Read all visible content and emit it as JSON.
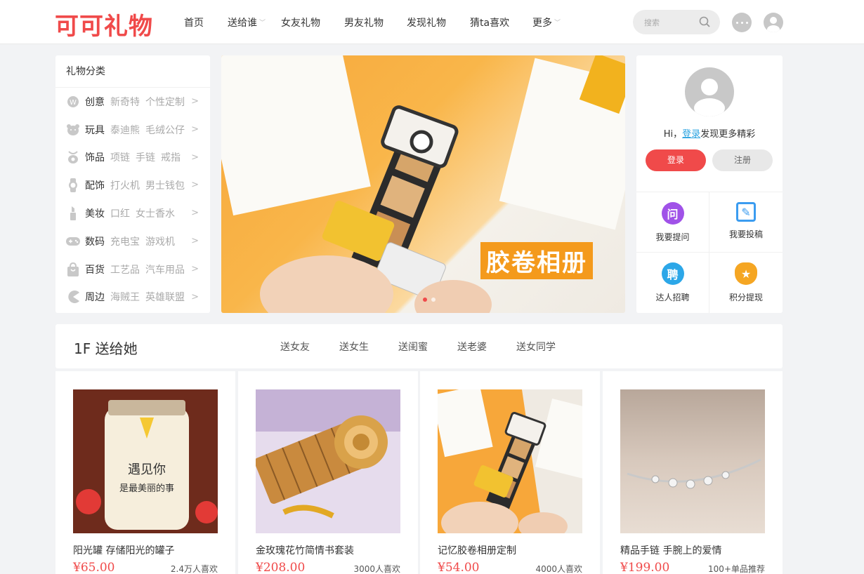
{
  "header": {
    "logo_text": "可可礼物",
    "nav": [
      {
        "label": "首页",
        "dropdown": false
      },
      {
        "label": "送给谁",
        "dropdown": true
      },
      {
        "label": "女友礼物",
        "dropdown": false
      },
      {
        "label": "男友礼物",
        "dropdown": false
      },
      {
        "label": "发现礼物",
        "dropdown": false
      },
      {
        "label": "猜ta喜欢",
        "dropdown": false
      },
      {
        "label": "更多",
        "dropdown": true
      }
    ],
    "search_placeholder": "搜索"
  },
  "categories": {
    "title": "礼物分类",
    "items": [
      {
        "name": "创意",
        "subs": [
          "新奇特",
          "个性定制"
        ],
        "icon": "creative-icon"
      },
      {
        "name": "玩具",
        "subs": [
          "泰迪熊",
          "毛绒公仔"
        ],
        "icon": "bear-icon"
      },
      {
        "name": "饰品",
        "subs": [
          "项链",
          "手链",
          "戒指"
        ],
        "icon": "jewelry-icon"
      },
      {
        "name": "配饰",
        "subs": [
          "打火机",
          "男士钱包"
        ],
        "icon": "watch-icon"
      },
      {
        "name": "美妆",
        "subs": [
          "口红",
          "女士香水"
        ],
        "icon": "lipstick-icon"
      },
      {
        "name": "数码",
        "subs": [
          "充电宝",
          "游戏机"
        ],
        "icon": "gamepad-icon"
      },
      {
        "name": "百货",
        "subs": [
          "工艺品",
          "汽车用品"
        ],
        "icon": "bag-icon"
      },
      {
        "name": "周边",
        "subs": [
          "海贼王",
          "英雄联盟"
        ],
        "icon": "pacman-icon"
      }
    ]
  },
  "banner": {
    "caption": "胶卷相册"
  },
  "user_panel": {
    "greeting_prefix": "Hi，",
    "greeting_link": "登录",
    "greeting_suffix": "发现更多精彩",
    "login_button": "登录",
    "register_button": "注册",
    "actions": [
      {
        "label": "我要提问",
        "icon": "question-icon",
        "glyph": "问",
        "color": "#a052e8"
      },
      {
        "label": "我要投稿",
        "icon": "edit-icon",
        "glyph": "✎",
        "color": "#3b9cf0"
      },
      {
        "label": "达人招聘",
        "icon": "recruit-icon",
        "glyph": "聘",
        "color": "#2ca7e8"
      },
      {
        "label": "积分提现",
        "icon": "moneybag-icon",
        "glyph": "★",
        "color": "#f5a623"
      }
    ]
  },
  "floor": {
    "title": "1F 送给她",
    "tabs": [
      "送女友",
      "送女生",
      "送闺蜜",
      "送老婆",
      "送女同学"
    ]
  },
  "products": [
    {
      "name": "阳光罐 存储阳光的罐子",
      "price": "¥65.00",
      "likes": "2.4万人喜欢"
    },
    {
      "name": "金玫瑰花竹简情书套装",
      "price": "¥208.00",
      "likes": "3000人喜欢"
    },
    {
      "name": "记忆胶卷相册定制",
      "price": "¥54.00",
      "likes": "4000人喜欢"
    },
    {
      "name": "精品手链 手腕上的爱情",
      "price": "¥199.00",
      "likes": "100+单品推荐"
    }
  ]
}
